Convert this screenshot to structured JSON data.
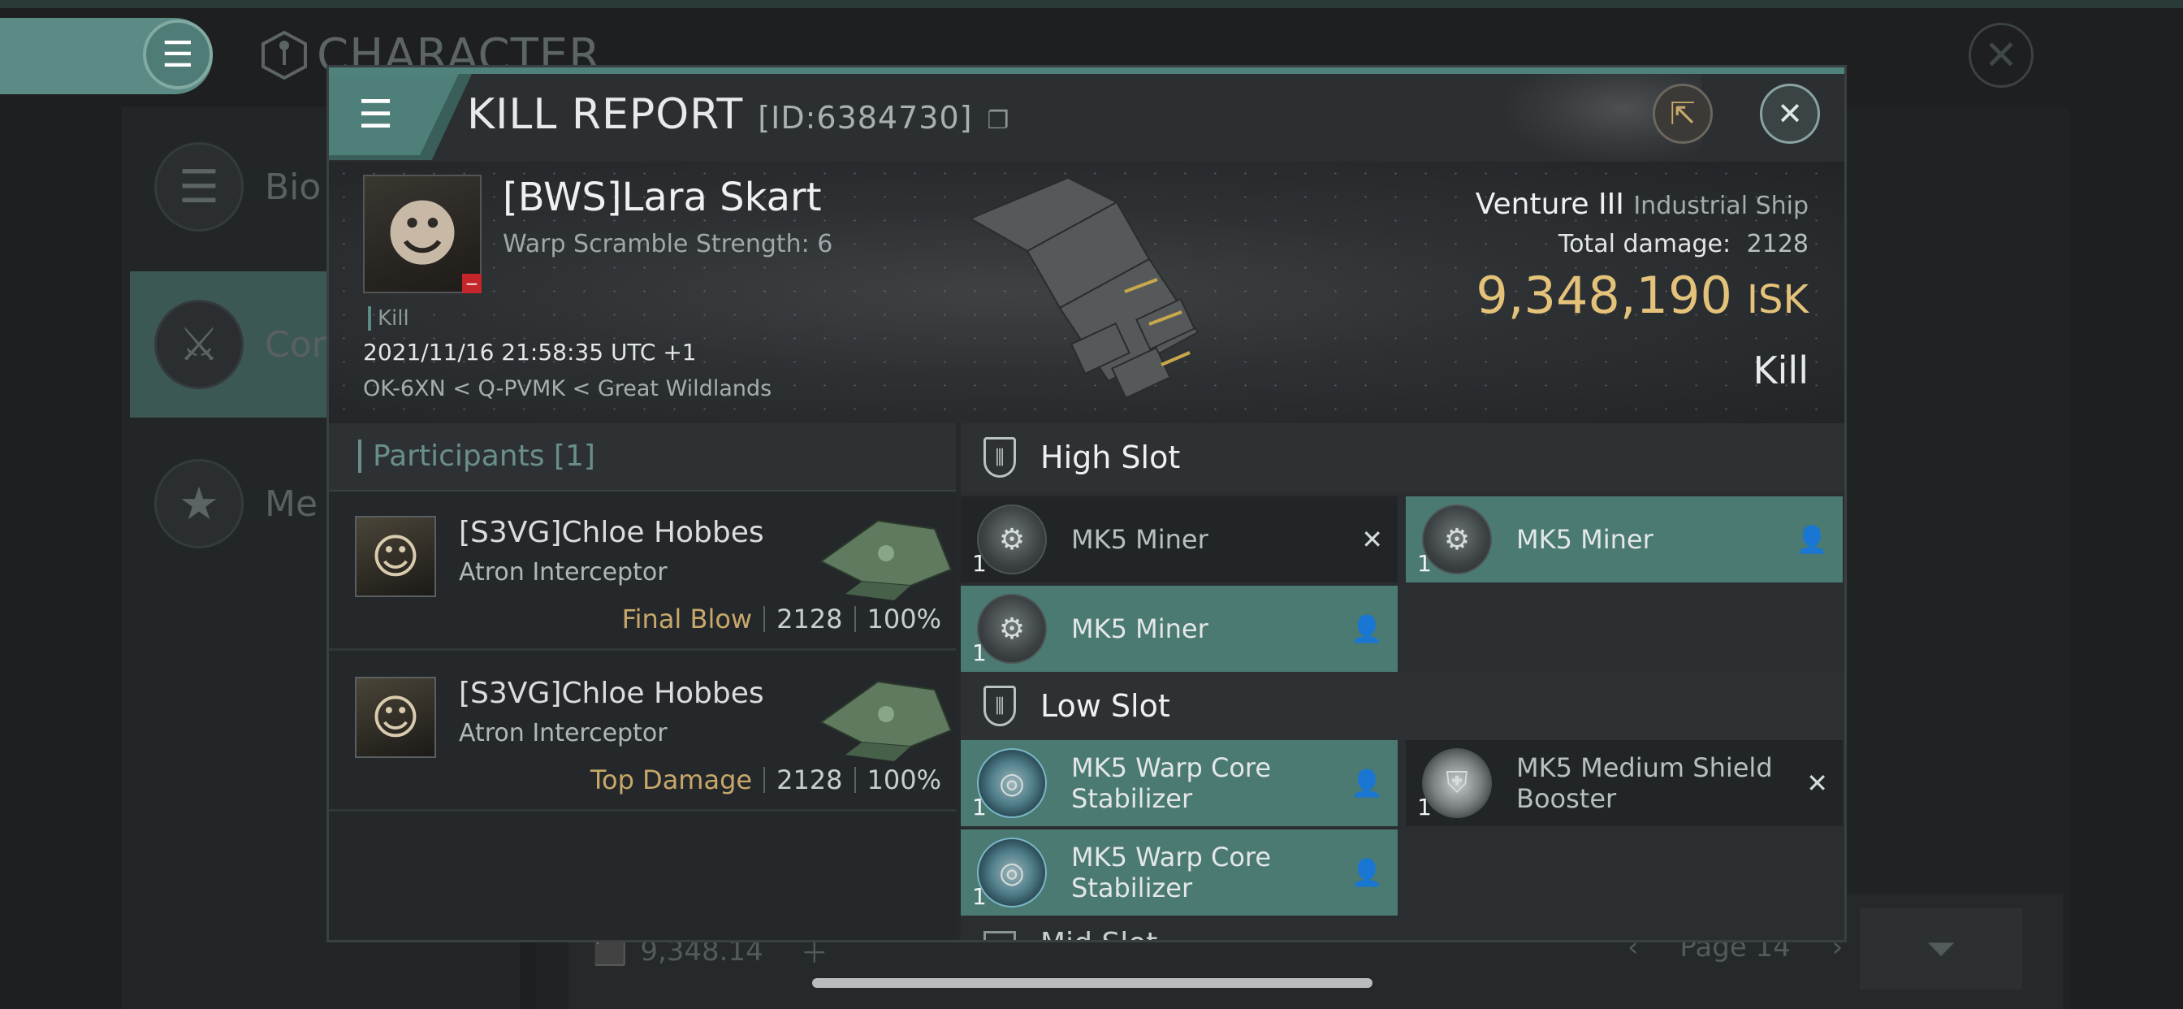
{
  "background": {
    "title": "CHARACTER",
    "menu_rows": [
      {
        "label": "Bio",
        "icon": "list-icon"
      },
      {
        "label": "Cor",
        "icon": "swords-icon"
      },
      {
        "label": "Me",
        "icon": "star-badge-icon"
      }
    ],
    "footer_isk": "9,348.14",
    "footer_page": "Page 14"
  },
  "dialog": {
    "title": "KILL REPORT",
    "report_id": "[ID:6384730]",
    "victim": {
      "name": "[BWS]Lara Skart",
      "warp_scramble": "Warp Scramble Strength: 6",
      "kill_tag": "Kill",
      "datetime": "2021/11/16 21:58:35 UTC +1",
      "location": "OK-6XN < Q-PVMK < Great Wildlands"
    },
    "ship": {
      "name": "Venture III",
      "class": "Industrial Ship",
      "total_damage_label": "Total damage:",
      "total_damage_value": "2128",
      "isk_value": "9,348,190",
      "isk_unit": "ISK",
      "result": "Kill"
    },
    "participants": {
      "title": "Participants [1]",
      "rows": [
        {
          "name": "[S3VG]Chloe Hobbes",
          "ship": "Atron Interceptor",
          "tag": "Final Blow",
          "damage": "2128",
          "percent": "100%"
        },
        {
          "name": "[S3VG]Chloe Hobbes",
          "ship": "Atron Interceptor",
          "tag": "Top Damage",
          "damage": "2128",
          "percent": "100%"
        }
      ]
    },
    "fitting": {
      "high_slot_label": "High Slot",
      "low_slot_label": "Low Slot",
      "mid_slot_label": "Mid Slot",
      "high_modules": [
        {
          "name": "MK5 Miner",
          "qty": "1",
          "state": "destroyed",
          "icon": "miner-icon"
        },
        {
          "name": "MK5 Miner",
          "qty": "1",
          "state": "dropped",
          "icon": "miner-icon"
        },
        {
          "name": "MK5 Miner",
          "qty": "1",
          "state": "dropped",
          "icon": "miner-icon"
        }
      ],
      "low_modules": [
        {
          "name": "MK5 Warp Core Stabilizer",
          "qty": "1",
          "state": "dropped",
          "icon": "warp-core-stabilizer-icon"
        },
        {
          "name": "MK5 Medium Shield Booster",
          "qty": "1",
          "state": "destroyed",
          "icon": "shield-booster-icon"
        },
        {
          "name": "MK5 Warp Core Stabilizer",
          "qty": "1",
          "state": "dropped",
          "icon": "warp-core-stabilizer-icon"
        }
      ]
    }
  },
  "colors": {
    "accent": "#4f7f79",
    "module_dropped": "#4b7a73",
    "isk_gold": "#e4c27a",
    "tag_gold": "#c8a86a"
  }
}
